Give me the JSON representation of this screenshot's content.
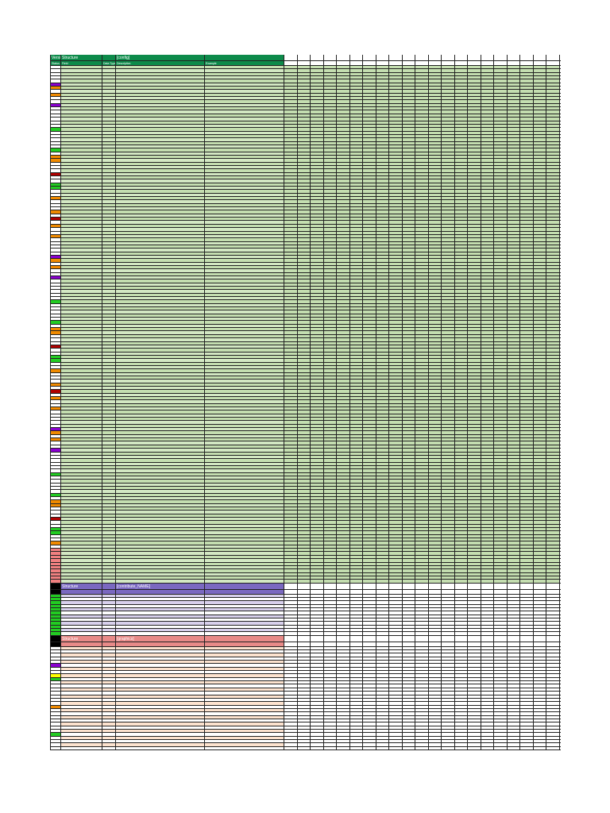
{
  "sections": [
    {
      "key": "config",
      "header": {
        "status": "Version",
        "field": "Structure",
        "description": "[config]"
      },
      "columns": {
        "status": "Status",
        "field": "Field",
        "type": "Data Type",
        "description": "Description",
        "example": "Example"
      },
      "header_color": "#0d8a4a",
      "row_color": "#c4deb0",
      "row_count": 150
    },
    {
      "key": "contribute",
      "header": {
        "status": "",
        "field": "Structure",
        "description": "[contribute_NAME]"
      },
      "header_color": "#7a68c0",
      "row_color": "#d8d0ec",
      "row_count": 12
    },
    {
      "key": "graphics",
      "header": {
        "status": "",
        "field": "Structure",
        "description": "[graphics]"
      },
      "header_color": "#e88a88",
      "row_color": "#fde3cf",
      "row_count": 30
    }
  ],
  "status_colors": {
    "none": "#ffffff",
    "orange": "#f08a00",
    "red": "#b00000",
    "green": "#22cc22",
    "purple": "#8a00d0",
    "yellow": "#ffff00",
    "pink": "#f08080",
    "black": "#000000"
  },
  "extra_columns": 21
}
